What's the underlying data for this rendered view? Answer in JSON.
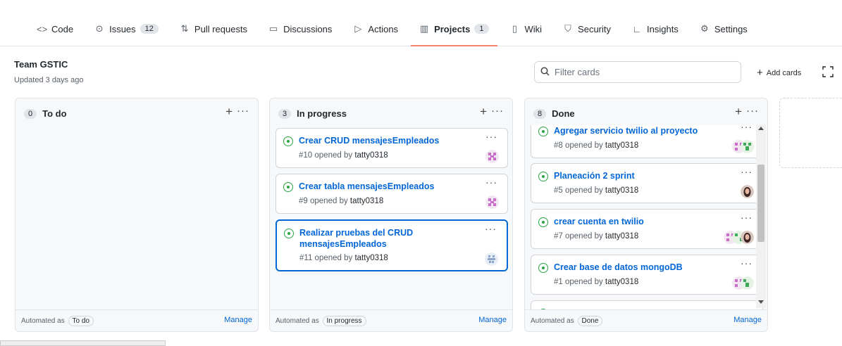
{
  "tabs": [
    {
      "icon": "code-icon",
      "label": "Code"
    },
    {
      "icon": "issue-icon",
      "label": "Issues",
      "count": "12"
    },
    {
      "icon": "pull-request-icon",
      "label": "Pull requests"
    },
    {
      "icon": "discussion-icon",
      "label": "Discussions"
    },
    {
      "icon": "play-icon",
      "label": "Actions"
    },
    {
      "icon": "project-icon",
      "label": "Projects",
      "count": "1",
      "active": true
    },
    {
      "icon": "book-icon",
      "label": "Wiki"
    },
    {
      "icon": "shield-icon",
      "label": "Security"
    },
    {
      "icon": "graph-icon",
      "label": "Insights"
    },
    {
      "icon": "gear-icon",
      "label": "Settings"
    }
  ],
  "board": {
    "title": "Team GSTIC",
    "subtitle": "Updated 3 days ago",
    "filter_placeholder": "Filter cards",
    "add_cards": "Add cards"
  },
  "columns": [
    {
      "count": "0",
      "title": "To do",
      "automated_label": "Automated as",
      "automated_value": "To do",
      "manage": "Manage",
      "cards": []
    },
    {
      "count": "3",
      "title": "In progress",
      "automated_label": "Automated as",
      "automated_value": "In progress",
      "manage": "Manage",
      "cards": [
        {
          "title": "Crear CRUD mensajesEmpleados",
          "number": "#10",
          "opened_by": "opened by",
          "user": "tatty0318"
        },
        {
          "title": "Crear tabla mensajesEmpleados",
          "number": "#9",
          "opened_by": "opened by",
          "user": "tatty0318"
        },
        {
          "title": "Realizar pruebas del CRUD mensajesEmpleados",
          "number": "#11",
          "opened_by": "opened by",
          "user": "tatty0318"
        }
      ]
    },
    {
      "count": "8",
      "title": "Done",
      "automated_label": "Automated as",
      "automated_value": "Done",
      "manage": "Manage",
      "cards": [
        {
          "title": "Agregar servicio twilio al proyecto",
          "number": "#8",
          "opened_by": "opened by",
          "user": "tatty0318"
        },
        {
          "title": "Planeación 2 sprint",
          "number": "#5",
          "opened_by": "opened by",
          "user": "tatty0318"
        },
        {
          "title": "crear cuenta en twilio",
          "number": "#7",
          "opened_by": "opened by",
          "user": "tatty0318"
        },
        {
          "title": "Crear base de datos mongoDB",
          "number": "#1",
          "opened_by": "opened by",
          "user": "tatty0318"
        }
      ]
    }
  ],
  "colors": {
    "accent": "#0366d6",
    "open_issue": "#28a745",
    "active_tab_underline": "#f9826c"
  }
}
